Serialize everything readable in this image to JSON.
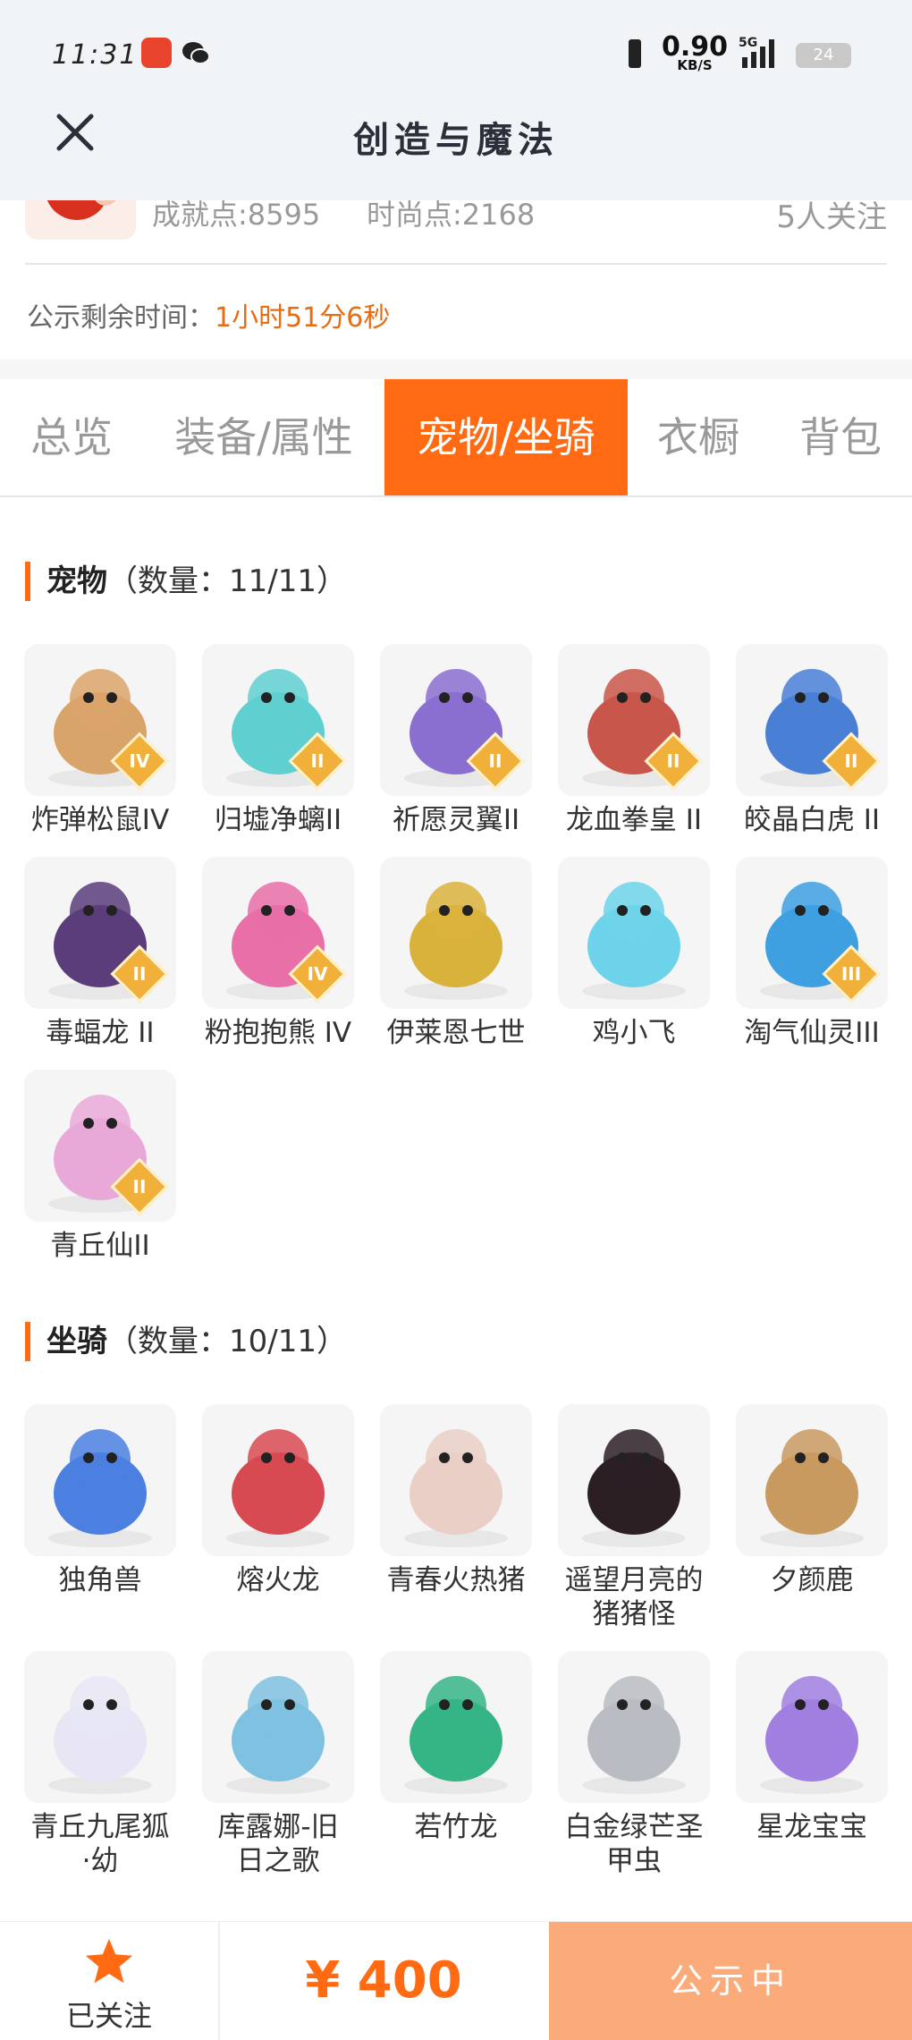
{
  "status_bar": {
    "time": "11:31",
    "net_speed": "0.90",
    "net_unit": "KB/S",
    "network": "5G",
    "battery": "24"
  },
  "header": {
    "title": "创造与魔法",
    "close_icon": "close-icon"
  },
  "profile": {
    "achievement": "成就点:8595",
    "fashion": "时尚点:2168",
    "followers": "5人关注"
  },
  "countdown": {
    "label": "公示剩余时间：",
    "value": "1小时51分6秒"
  },
  "tabs": [
    {
      "label": "总览"
    },
    {
      "label": "装备/属性"
    },
    {
      "label": "宠物/坐骑",
      "active": true
    },
    {
      "label": "衣橱"
    },
    {
      "label": "背包"
    }
  ],
  "pets": {
    "title": "宠物",
    "count": "（数量：11/11）",
    "items": [
      {
        "name": "炸弹松鼠IV",
        "badge": "IV",
        "icon": "squirrel-pet-icon",
        "color": "#d9a46a"
      },
      {
        "name": "归墟净螭II",
        "badge": "II",
        "icon": "water-dragon-pet-icon",
        "color": "#5fcfd0"
      },
      {
        "name": "祈愿灵翼II",
        "badge": "II",
        "icon": "eagle-pet-icon",
        "color": "#8a6fd0"
      },
      {
        "name": "龙血拳皇 II",
        "badge": "II",
        "icon": "ram-pet-icon",
        "color": "#c9564a"
      },
      {
        "name": "皎晶白虎 II",
        "badge": "II",
        "icon": "tiger-pet-icon",
        "color": "#4a7fd6"
      },
      {
        "name": "毒蝠龙 II",
        "badge": "II",
        "icon": "bat-dragon-pet-icon",
        "color": "#5a3d7a"
      },
      {
        "name": "粉抱抱熊 IV",
        "badge": "IV",
        "icon": "bear-pet-icon",
        "color": "#e86fa8"
      },
      {
        "name": "伊莱恩七世",
        "badge": "",
        "icon": "queen-pet-icon",
        "color": "#d9b23c"
      },
      {
        "name": "鸡小飞",
        "badge": "",
        "icon": "chick-pet-icon",
        "color": "#6dd3ea"
      },
      {
        "name": "淘气仙灵III",
        "badge": "III",
        "icon": "fairy-dog-pet-icon",
        "color": "#3ea0e0"
      },
      {
        "name": "青丘仙II",
        "badge": "II",
        "icon": "fox-fairy-pet-icon",
        "color": "#e9a9d8"
      }
    ]
  },
  "mounts": {
    "title": "坐骑",
    "count": "（数量：10/11）",
    "items": [
      {
        "name": "独角兽",
        "icon": "unicorn-mount-icon",
        "color": "#4b7fe0"
      },
      {
        "name": "熔火龙",
        "icon": "fire-dragon-mount-icon",
        "color": "#d84a52"
      },
      {
        "name": "青春火热猪",
        "icon": "pig-mount-icon",
        "color": "#e9cfc6"
      },
      {
        "name": "遥望月亮的\n猪猪怪",
        "icon": "black-pig-mount-icon",
        "color": "#2b1f24"
      },
      {
        "name": "夕颜鹿",
        "icon": "deer-mount-icon",
        "color": "#c99a60"
      },
      {
        "name": "青丘九尾狐\n·幼",
        "icon": "nine-tail-fox-mount-icon",
        "color": "#e8e6f4"
      },
      {
        "name": "库露娜-旧\n日之歌",
        "icon": "kuluna-mount-icon",
        "color": "#7fc1e0"
      },
      {
        "name": "若竹龙",
        "icon": "bamboo-dragon-mount-icon",
        "color": "#35b585"
      },
      {
        "name": "白金绿芒圣\n甲虫",
        "icon": "beetle-mount-icon",
        "color": "#b9bcc2"
      },
      {
        "name": "星龙宝宝",
        "icon": "baby-star-dragon-mount-icon",
        "color": "#a07fe0"
      }
    ]
  },
  "bottom_bar": {
    "follow_label": "已关注",
    "price": "¥ 400",
    "state": "公示中"
  },
  "colors": {
    "accent": "#ff6a13",
    "state_bg": "#fbaa7a",
    "countdown": "#e86c12"
  }
}
